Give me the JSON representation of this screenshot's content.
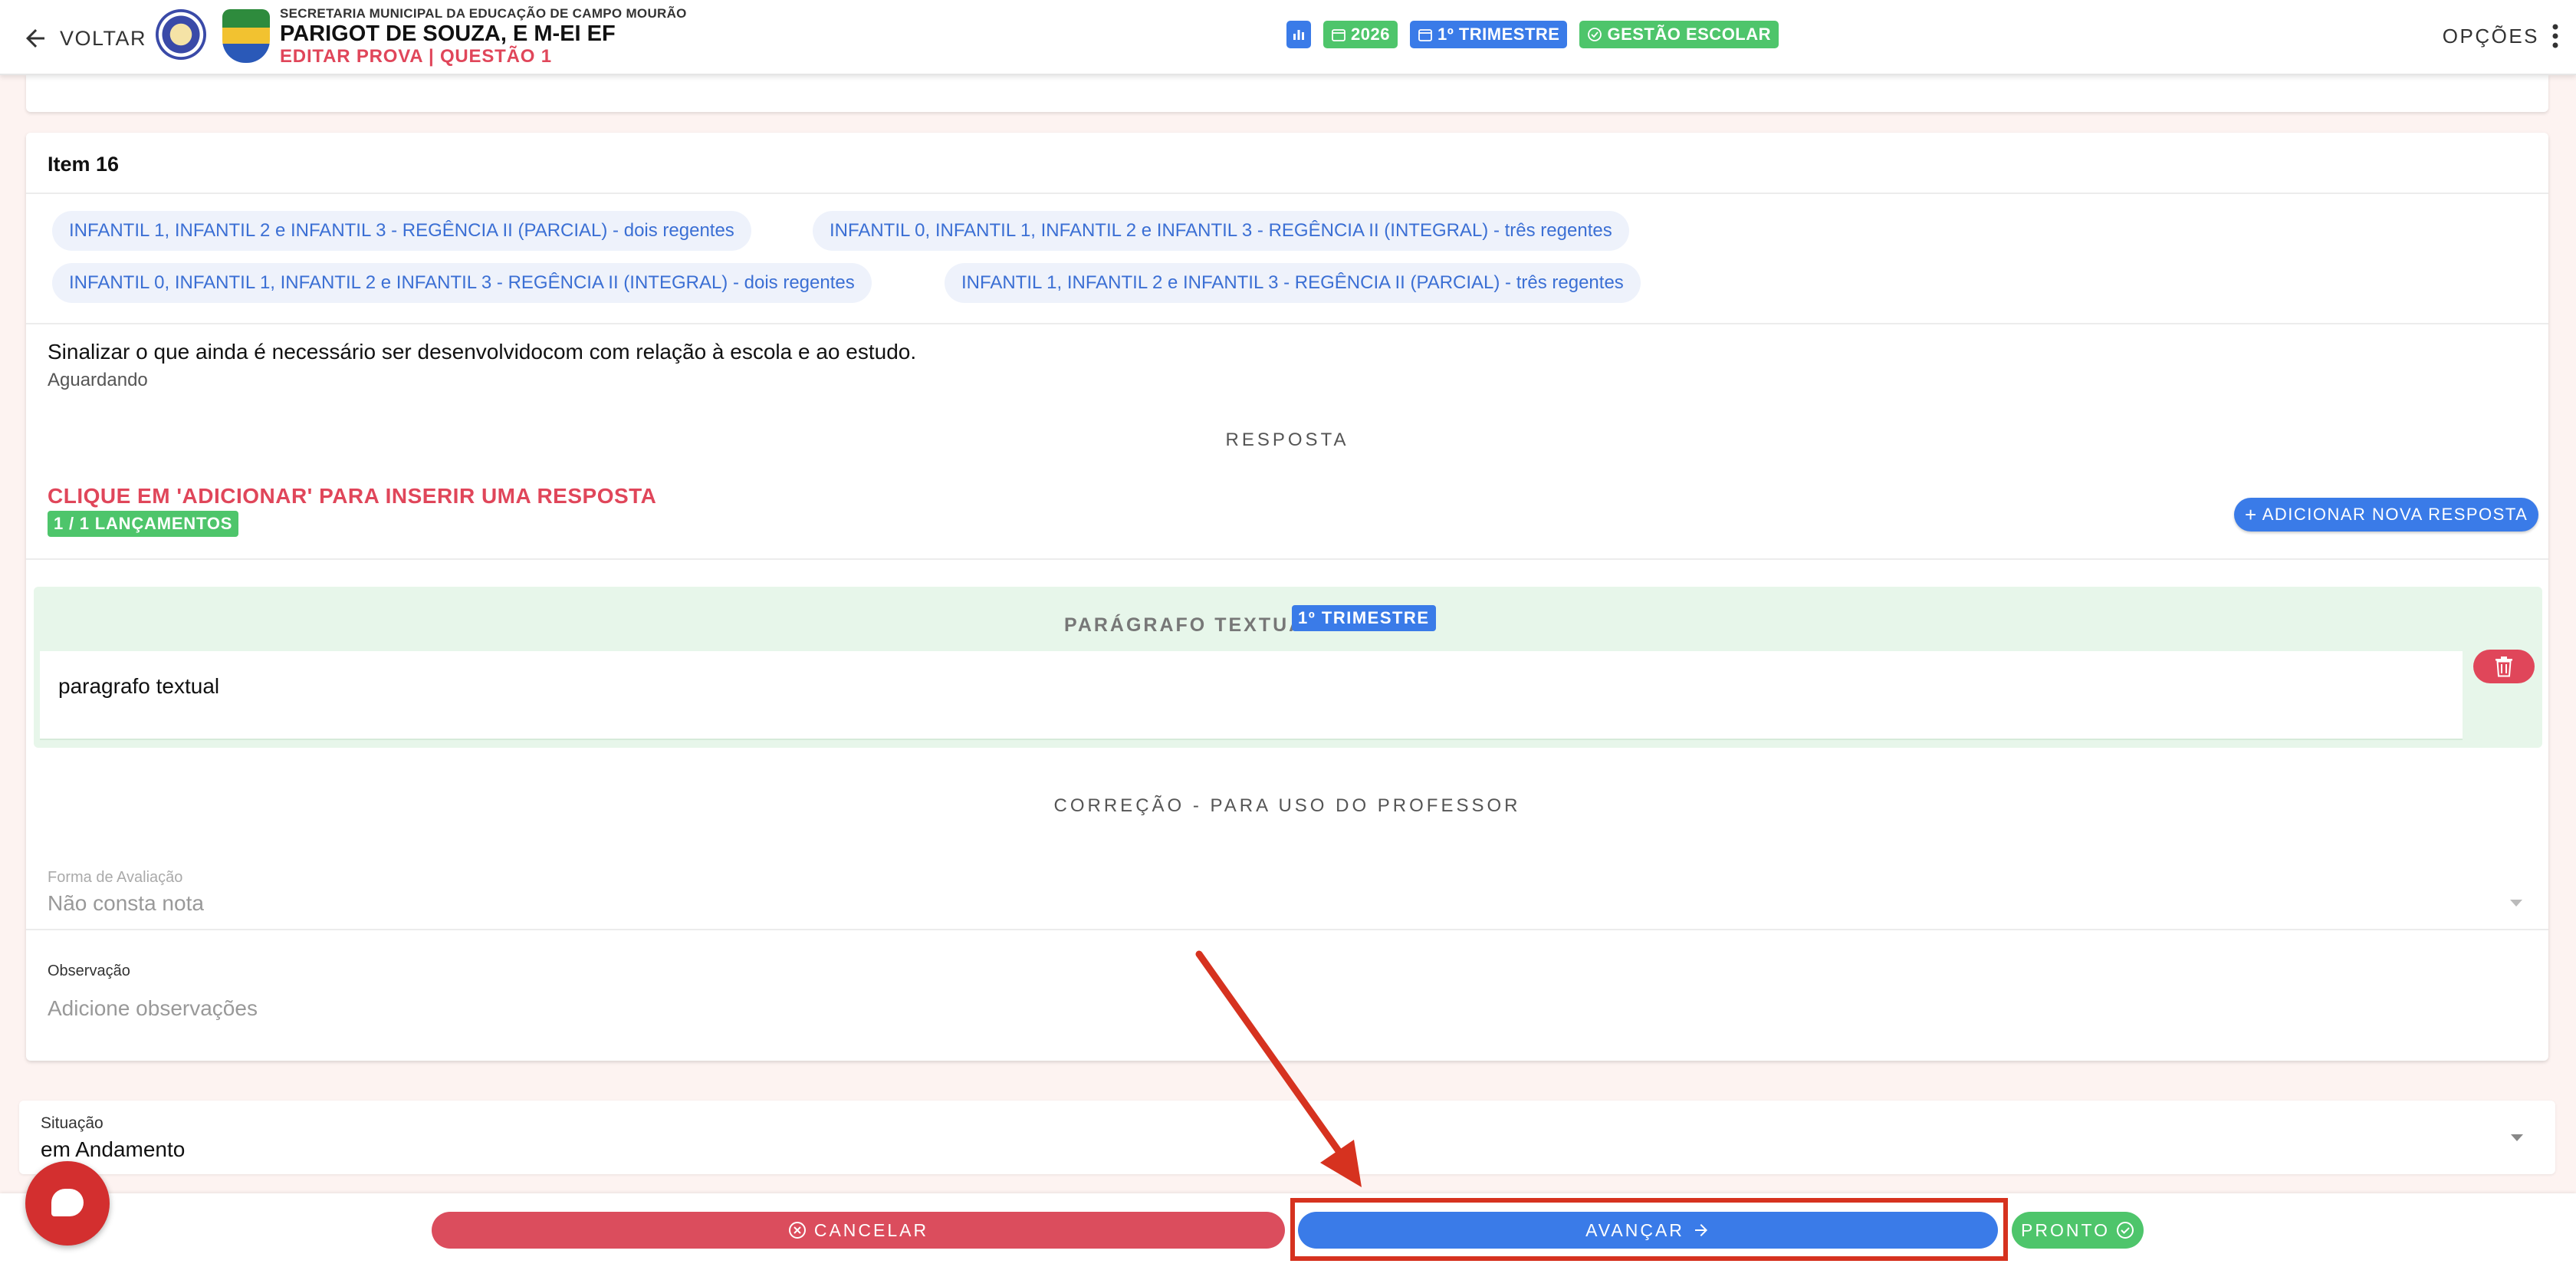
{
  "header": {
    "back_label": "VOLTAR",
    "secretaria": "SECRETARIA MUNICIPAL DA EDUCAÇÃO DE CAMPO MOURÃO",
    "school": "PARIGOT DE SOUZA, E M-EI EF",
    "subtitle": "EDITAR PROVA | QUESTÃO 1",
    "chips": {
      "year": "2026",
      "term": "1º TRIMESTRE",
      "gestao": "GESTÃO ESCOLAR"
    },
    "options_label": "OPÇÕES"
  },
  "item": {
    "title": "Item 16",
    "tags": [
      "INFANTIL 1, INFANTIL 2 e INFANTIL 3 - REGÊNCIA II (PARCIAL) - dois regentes",
      "INFANTIL 0, INFANTIL 1, INFANTIL 2 e INFANTIL 3 - REGÊNCIA II (INTEGRAL) - três regentes",
      "INFANTIL 0, INFANTIL 1, INFANTIL 2 e INFANTIL 3 - REGÊNCIA II (INTEGRAL) - dois regentes",
      "INFANTIL 1, INFANTIL 2 e INFANTIL 3 - REGÊNCIA II (PARCIAL) - três regentes"
    ],
    "question": "Sinalizar o que ainda é necessário ser desenvolvidocom com relação à escola e ao estudo.",
    "status": "Aguardando"
  },
  "response": {
    "heading": "RESPOSTA",
    "warning": "CLIQUE EM 'ADICIONAR' PARA INSERIR UMA RESPOSTA",
    "count": "1 / 1 LANÇAMENTOS",
    "add_label": "ADICIONAR NOVA RESPOSTA",
    "answer_label": "PARÁGRAFO TEXTUAL:",
    "answer_badge": "1º TRIMESTRE",
    "answer_text": "paragrafo textual"
  },
  "correction": {
    "heading": "CORREÇÃO - PARA USO DO PROFESSOR",
    "eval_label": "Forma de Avaliação",
    "eval_value": "Não consta nota",
    "obs_label": "Observação",
    "obs_placeholder": "Adicione observações"
  },
  "situation": {
    "label": "Situação",
    "value": "em Andamento"
  },
  "footer": {
    "cancel_label": "CANCELAR",
    "next_label": "AVANÇAR",
    "ready_label": "PRONTO"
  },
  "colors": {
    "primary": "#3a7be8",
    "danger": "#db4d5d",
    "success": "#4ec56b",
    "annotation": "#d6321f"
  }
}
